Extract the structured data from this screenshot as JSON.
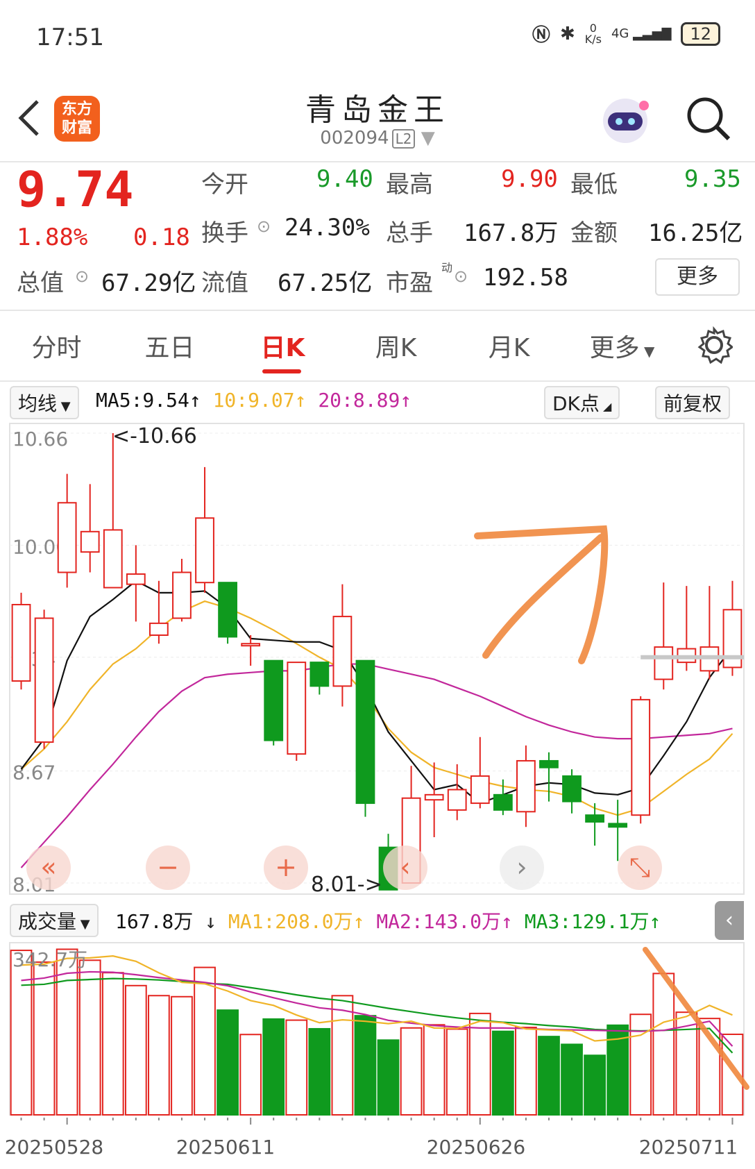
{
  "status_bar": {
    "time": "17:51",
    "network_speed": "0\nK/s",
    "network_speed_top": "0",
    "network_speed_bottom": "K/s",
    "signal": "4G",
    "battery": "12"
  },
  "header": {
    "title": "青岛金王",
    "code": "002094",
    "level": "L2",
    "logo_line1": "东方",
    "logo_line2": "财富"
  },
  "quote": {
    "price": "9.74",
    "change_pct": "1.88%",
    "change": "0.18",
    "open_label": "今开",
    "open": "9.40",
    "high_label": "最高",
    "high": "9.90",
    "low_label": "最低",
    "low": "9.35",
    "turnover_label": "换手",
    "turnover": "24.30%",
    "volume_label": "总手",
    "volume": "167.8万",
    "amount_label": "金额",
    "amount": "16.25亿",
    "mktcap_label": "总值",
    "mktcap": "67.29亿",
    "float_label": "流值",
    "float": "67.25亿",
    "pe_label": "市盈",
    "pe_sup": "动",
    "pe": "192.58",
    "more_label": "更多"
  },
  "tabs": [
    {
      "label": "分时"
    },
    {
      "label": "五日"
    },
    {
      "label": "日K",
      "active": true
    },
    {
      "label": "周K"
    },
    {
      "label": "月K"
    },
    {
      "label": "更多"
    }
  ],
  "indicator_bar": {
    "ma_select": "均线",
    "ma5": "MA5:9.54",
    "ma10": "10:9.07",
    "ma20": "20:8.89",
    "dk_button": "DK点",
    "adjust_button": "前复权"
  },
  "volume_bar": {
    "select": "成交量",
    "current": "167.8万",
    "ma1": "MA1:208.0万",
    "ma2": "MA2:143.0万",
    "ma3": "MA3:129.1万"
  },
  "colors": {
    "up": "#e3241f",
    "down": "#0f9a1e",
    "ma5": "#111111",
    "ma10": "#f0b429",
    "ma20": "#c2279b",
    "annotation": "#f0883e"
  },
  "icons": [
    "back-icon",
    "robot-avatar-icon",
    "search-icon",
    "gear-icon",
    "rewind-icon",
    "zoom-out-icon",
    "zoom-in-icon",
    "prev-icon",
    "next-icon",
    "expand-icon",
    "collapse-icon"
  ],
  "chart_data": {
    "type": "candlestick",
    "y_ticks": [
      "10.66",
      "10.00",
      "9.34",
      "8.67",
      "8.01"
    ],
    "ylim": [
      8.01,
      10.66
    ],
    "max_label": "<-10.66",
    "min_label": "8.01->",
    "x_labels": [
      "20250528",
      "20250611",
      "20250626",
      "20250711"
    ],
    "candles": [
      {
        "o": 9.2,
        "c": 9.65,
        "h": 9.72,
        "l": 9.15
      },
      {
        "o": 8.84,
        "c": 9.57,
        "h": 9.62,
        "l": 8.8
      },
      {
        "o": 9.84,
        "c": 10.25,
        "h": 10.42,
        "l": 9.75
      },
      {
        "o": 9.96,
        "c": 10.08,
        "h": 10.36,
        "l": 9.84
      },
      {
        "o": 9.75,
        "c": 10.09,
        "h": 10.66,
        "l": 9.75
      },
      {
        "o": 9.77,
        "c": 9.83,
        "h": 10.0,
        "l": 9.55
      },
      {
        "o": 9.47,
        "c": 9.54,
        "h": 9.79,
        "l": 9.42
      },
      {
        "o": 9.57,
        "c": 9.84,
        "h": 9.92,
        "l": 9.55
      },
      {
        "o": 9.78,
        "c": 10.16,
        "h": 10.46,
        "l": 9.72
      },
      {
        "o": 9.78,
        "c": 9.46,
        "h": 9.78,
        "l": 9.42
      },
      {
        "o": 9.41,
        "c": 9.42,
        "h": 9.47,
        "l": 9.29
      },
      {
        "o": 9.32,
        "c": 8.85,
        "h": 9.32,
        "l": 8.82
      },
      {
        "o": 8.77,
        "c": 9.31,
        "h": 9.31,
        "l": 8.73
      },
      {
        "o": 9.31,
        "c": 9.17,
        "h": 9.31,
        "l": 9.12
      },
      {
        "o": 9.17,
        "c": 9.58,
        "h": 9.77,
        "l": 9.05
      },
      {
        "o": 9.32,
        "c": 8.48,
        "h": 9.32,
        "l": 8.4
      },
      {
        "o": 8.22,
        "c": 7.97,
        "h": 8.3,
        "l": 8.01
      },
      {
        "o": 8.01,
        "c": 8.51,
        "h": 8.7,
        "l": 8.01
      },
      {
        "o": 8.5,
        "c": 8.53,
        "h": 8.72,
        "l": 8.28
      },
      {
        "o": 8.44,
        "c": 8.56,
        "h": 8.71,
        "l": 8.38
      },
      {
        "o": 8.48,
        "c": 8.64,
        "h": 8.87,
        "l": 8.45
      },
      {
        "o": 8.53,
        "c": 8.44,
        "h": 8.62,
        "l": 8.41
      },
      {
        "o": 8.43,
        "c": 8.73,
        "h": 8.82,
        "l": 8.34
      },
      {
        "o": 8.73,
        "c": 8.69,
        "h": 8.78,
        "l": 8.49
      },
      {
        "o": 8.64,
        "c": 8.49,
        "h": 8.68,
        "l": 8.42
      },
      {
        "o": 8.41,
        "c": 8.37,
        "h": 8.48,
        "l": 8.23
      },
      {
        "o": 8.36,
        "c": 8.34,
        "h": 8.5,
        "l": 8.14
      },
      {
        "o": 8.41,
        "c": 9.09,
        "h": 9.11,
        "l": 8.36
      },
      {
        "o": 9.21,
        "c": 9.4,
        "h": 9.78,
        "l": 9.15
      },
      {
        "o": 9.31,
        "c": 9.39,
        "h": 9.76,
        "l": 9.26
      },
      {
        "o": 9.26,
        "c": 9.4,
        "h": 9.76,
        "l": 9.21
      },
      {
        "o": 9.28,
        "c": 9.62,
        "h": 9.79,
        "l": 9.23
      }
    ],
    "ma5": [
      8.68,
      8.86,
      9.32,
      9.58,
      9.68,
      9.79,
      9.72,
      9.72,
      9.73,
      9.63,
      9.45,
      9.44,
      9.43,
      9.43,
      9.38,
      9.17,
      8.9,
      8.73,
      8.56,
      8.59,
      8.48,
      8.53,
      8.58,
      8.6,
      8.59,
      8.54,
      8.53,
      8.57,
      8.76,
      8.96,
      9.22,
      9.4
    ],
    "ma10": [
      8.68,
      8.8,
      8.96,
      9.15,
      9.3,
      9.39,
      9.51,
      9.61,
      9.67,
      9.63,
      9.57,
      9.5,
      9.42,
      9.34,
      9.27,
      9.12,
      8.92,
      8.78,
      8.69,
      8.65,
      8.61,
      8.58,
      8.56,
      8.55,
      8.52,
      8.45,
      8.41,
      8.45,
      8.55,
      8.65,
      8.74,
      8.89
    ],
    "ma20": [
      8.1,
      8.25,
      8.4,
      8.56,
      8.71,
      8.87,
      9.02,
      9.14,
      9.22,
      9.24,
      9.25,
      9.26,
      9.26,
      9.28,
      9.3,
      9.3,
      9.27,
      9.24,
      9.21,
      9.16,
      9.11,
      9.05,
      8.99,
      8.94,
      8.9,
      8.87,
      8.86,
      8.86,
      8.87,
      8.88,
      8.89,
      8.92
    ],
    "volume": {
      "ymax_label": "342.7万",
      "values": [
        342.7,
        318.2,
        345.0,
        322.1,
        296.2,
        269.3,
        248.4,
        246.2,
        307.2,
        218.2,
        167.4,
        199.6,
        197.3,
        179.4,
        248.3,
        206.6,
        155.8,
        181.1,
        187.6,
        178.7,
        211.3,
        174.0,
        182.2,
        163.2,
        146.9,
        124.0,
        186.8,
        209.4,
        294.5,
        213.8,
        200.8,
        167.8
      ],
      "ma1": [
        312,
        314,
        326,
        327,
        331,
        320,
        296,
        276,
        273,
        258,
        238,
        228,
        208,
        192,
        198,
        195,
        190,
        195,
        181,
        180,
        195,
        192,
        179,
        177,
        175,
        154,
        158,
        166,
        193,
        205,
        228,
        208
      ],
      "ma2": [
        280,
        285,
        295,
        298,
        297,
        292,
        286,
        281,
        276,
        269,
        256,
        244,
        233,
        223,
        218,
        209,
        197,
        191,
        186,
        183,
        181,
        181,
        180,
        178,
        177,
        176,
        175,
        174,
        176,
        185,
        195,
        143
      ],
      "ma3": [
        270,
        272,
        280,
        282,
        284,
        283,
        281,
        278,
        274,
        272,
        265,
        258,
        250,
        243,
        238,
        230,
        222,
        215,
        208,
        202,
        197,
        193,
        190,
        186,
        183,
        178,
        176,
        175,
        176,
        178,
        180,
        129
      ]
    }
  }
}
